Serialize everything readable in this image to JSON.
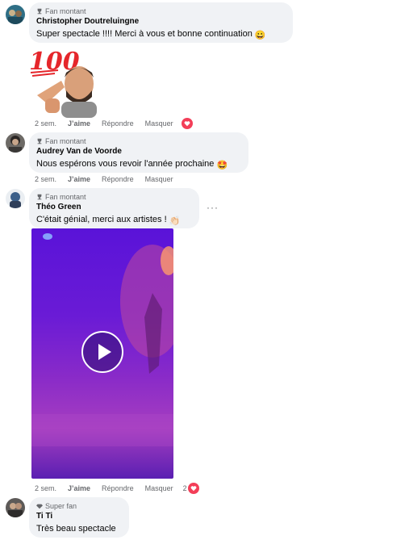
{
  "comments": [
    {
      "badge": "Fan montant",
      "author": "Christopher Doutreluingne",
      "text": "Super spectacle !!!! Merci à vous et bonne continuation",
      "text_emoji": "😀",
      "sticker": "100-emoji sticker with bearded memoji pointing",
      "actions": {
        "time": "2 sem.",
        "like": "J’aime",
        "reply": "Répondre",
        "hide": "Masquer"
      },
      "reaction": {
        "icon": "heart-icon",
        "color": "#f33e58"
      }
    },
    {
      "badge": "Fan montant",
      "author": "Audrey Van de Voorde",
      "text": "Nous espérons vous revoir l'année prochaine",
      "text_emoji": "🤩",
      "actions": {
        "time": "2 sem.",
        "like": "J’aime",
        "reply": "Répondre",
        "hide": "Masquer"
      }
    },
    {
      "badge": "Fan montant",
      "author": "Théo Green",
      "text": "C'était génial, merci aux artistes !",
      "text_emoji": "👏🏻",
      "more": "···",
      "actions": {
        "time": "2 sem.",
        "like": "J’aime",
        "reply": "Répondre",
        "hide": "Masquer"
      },
      "reaction": {
        "count": "2",
        "icon": "heart-icon",
        "color": "#f33e58"
      }
    },
    {
      "badge": "Super fan",
      "author": "Ti Ti",
      "text": "Très beau spectacle"
    }
  ],
  "colors": {
    "bubble": "#f0f2f5",
    "meta": "#65676b",
    "heart": "#f33e58"
  }
}
